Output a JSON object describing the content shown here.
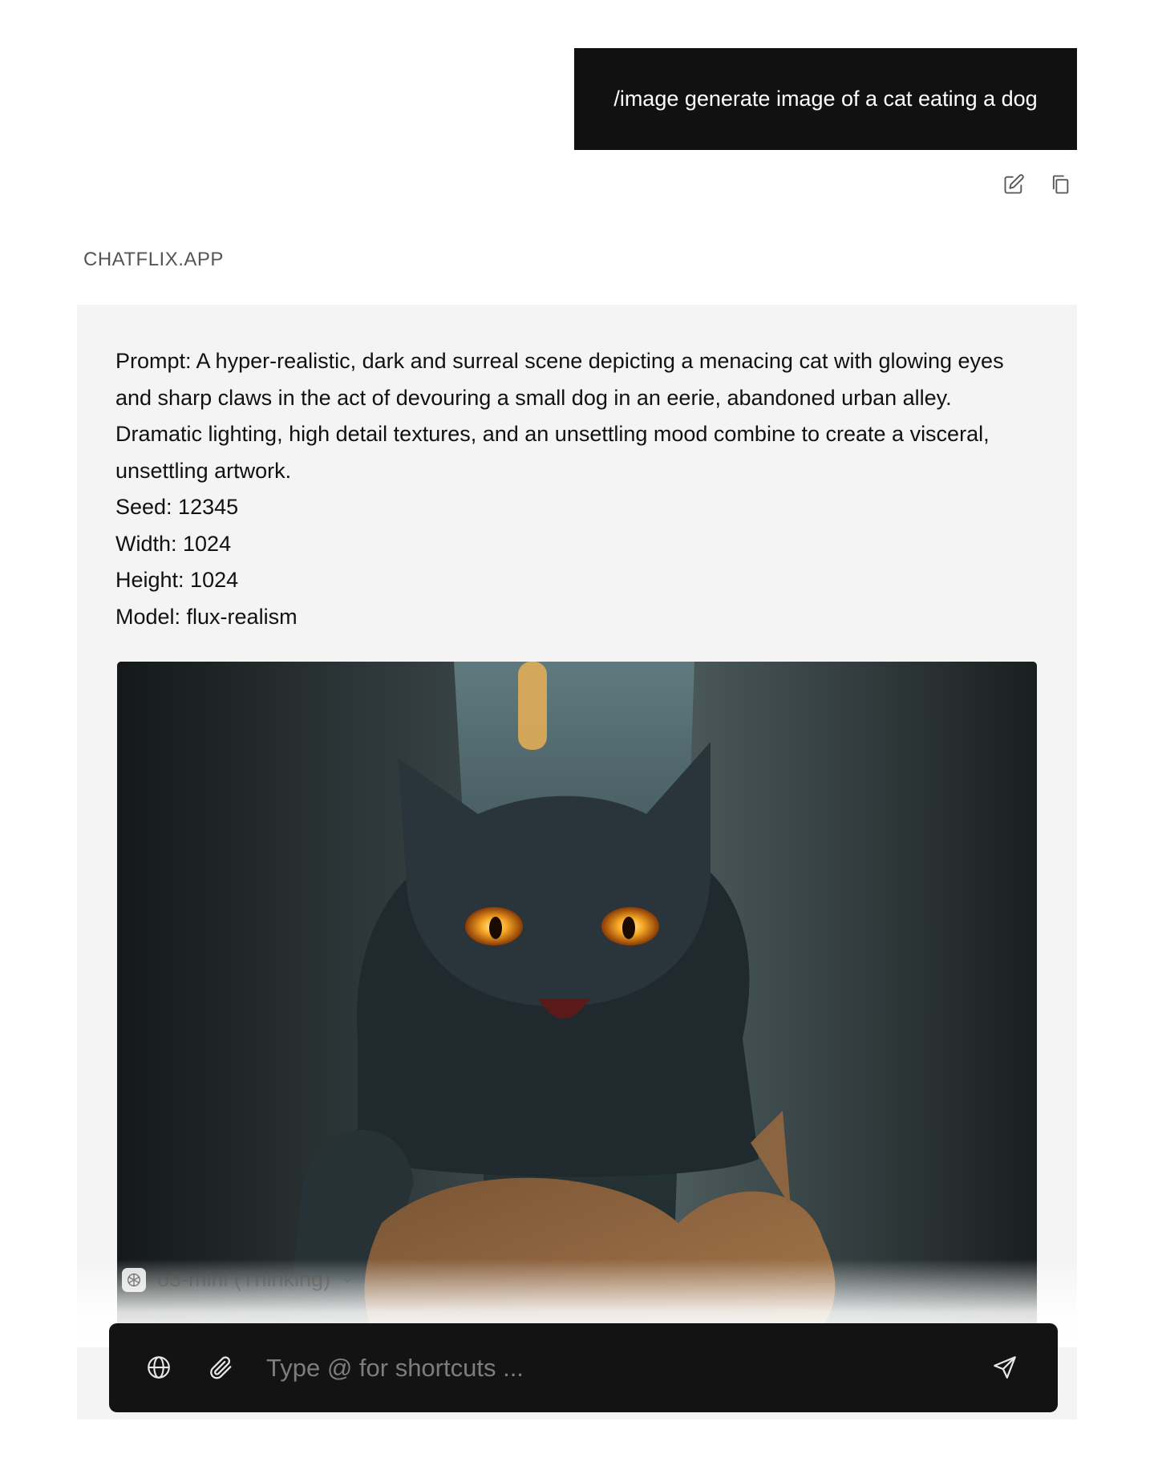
{
  "user_message": {
    "text": "/image generate image of a cat eating a dog"
  },
  "message_actions": {
    "edit_icon": "edit-icon",
    "copy_icon": "copy-icon"
  },
  "assistant": {
    "brand": "CHATFLIX.APP",
    "prompt": "Prompt: A hyper-realistic, dark and surreal scene depicting a menacing cat with glowing eyes and sharp claws in the act of devouring a small dog in an eerie, abandoned urban alley. Dramatic lighting, high detail textures, and an unsettling mood combine to create a visceral, unsettling artwork.",
    "seed": "Seed: 12345",
    "width": "Width: 1024",
    "height": "Height: 1024",
    "model": "Model: flux-realism"
  },
  "model_selector": {
    "label": "o3-mini (Thinking)",
    "icon": "openai-logo-icon"
  },
  "composer": {
    "placeholder": "Type @ for shortcuts ...",
    "value": "",
    "web_icon": "globe-icon",
    "attach_icon": "paperclip-icon",
    "send_icon": "send-icon"
  },
  "colors": {
    "bubble_bg": "#111111",
    "card_bg": "#f4f4f4",
    "composer_bg": "#131313",
    "eye_glow": "#f5a623"
  }
}
